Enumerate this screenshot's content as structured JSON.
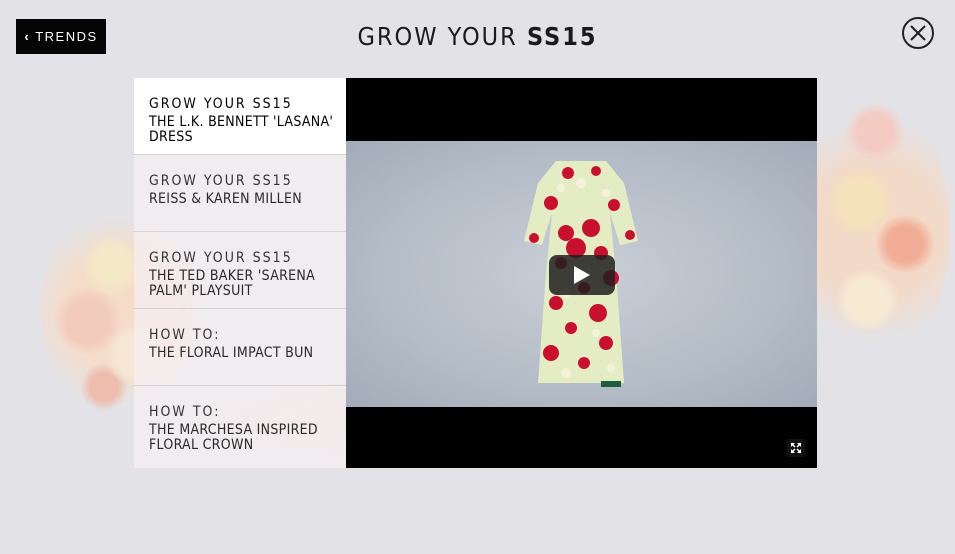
{
  "nav": {
    "back_label": "TRENDS"
  },
  "header": {
    "title_light": "GROW YOUR",
    "title_bold": "SS15"
  },
  "playlist": {
    "items": [
      {
        "heading": "GROW YOUR SS15",
        "subtitle_line1": "THE L.K. BENNETT 'LASANA'",
        "subtitle_line2": "DRESS",
        "active": true
      },
      {
        "heading": "GROW YOUR SS15",
        "subtitle_line1": "REISS & KAREN MILLEN",
        "subtitle_line2": "",
        "active": false
      },
      {
        "heading": "GROW YOUR SS15",
        "subtitle_line1": "THE TED BAKER 'SARENA",
        "subtitle_line2": "PALM' PLAYSUIT",
        "active": false
      },
      {
        "heading": "HOW TO:",
        "subtitle_line1": "THE FLORAL IMPACT BUN",
        "subtitle_line2": "",
        "active": false
      },
      {
        "heading": "HOW TO:",
        "subtitle_line1": "THE MARCHESA INSPIRED",
        "subtitle_line2": "FLORAL CROWN",
        "active": false
      }
    ]
  },
  "icons": {
    "back": "chevron-left-icon",
    "close": "close-icon",
    "play": "play-icon",
    "fullscreen": "fullscreen-icon"
  },
  "colors": {
    "background": "#e3e3e7",
    "button_dark": "#050505",
    "player_bg": "#000000",
    "active_item": "#ffffff"
  }
}
